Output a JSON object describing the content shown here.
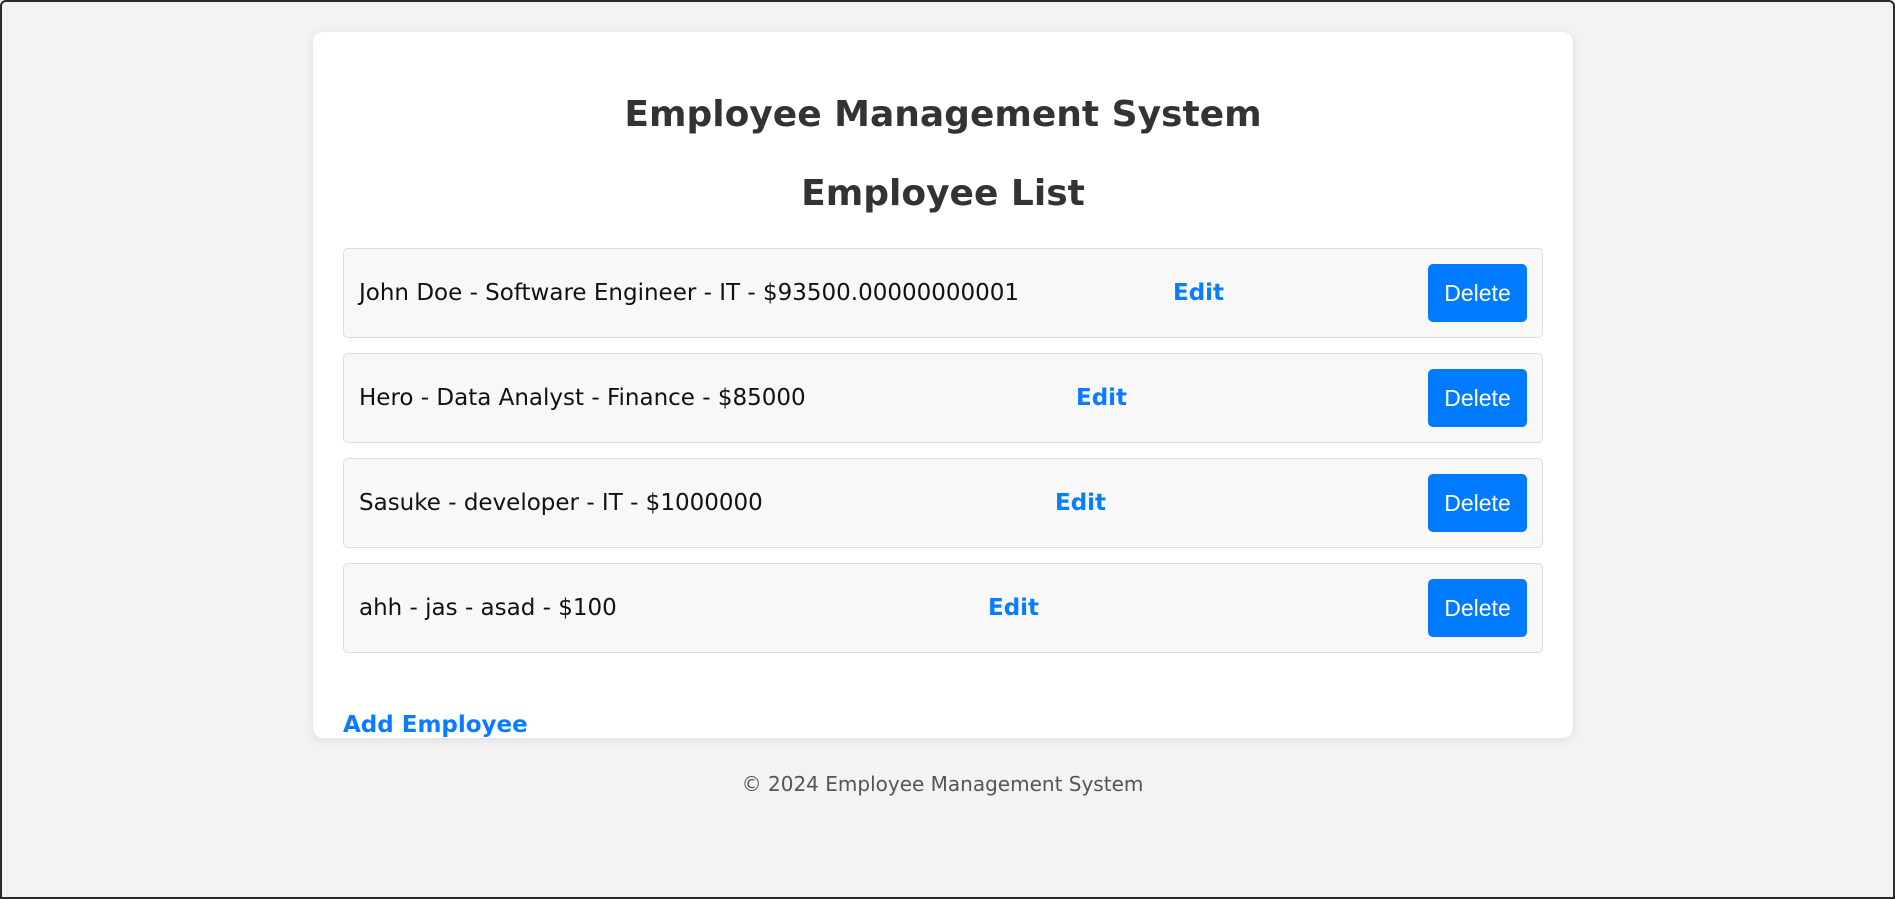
{
  "header": {
    "title": "Employee Management System",
    "subtitle": "Employee List"
  },
  "employees": [
    {
      "text": "John Doe - Software Engineer - IT - $93500.00000000001",
      "edit_label": "Edit",
      "delete_label": "Delete"
    },
    {
      "text": "Hero - Data Analyst - Finance - $85000",
      "edit_label": "Edit",
      "delete_label": "Delete"
    },
    {
      "text": "Sasuke - developer - IT - $1000000",
      "edit_label": "Edit",
      "delete_label": "Delete"
    },
    {
      "text": "ahh - jas - asad - $100",
      "edit_label": "Edit",
      "delete_label": "Delete"
    }
  ],
  "actions": {
    "add_label": "Add Employee"
  },
  "footer": {
    "text": "© 2024 Employee Management System"
  },
  "colors": {
    "accent": "#007bff",
    "link": "#0a7cff",
    "row_bg": "#f8f8f8",
    "page_bg": "#f3f3f3"
  }
}
